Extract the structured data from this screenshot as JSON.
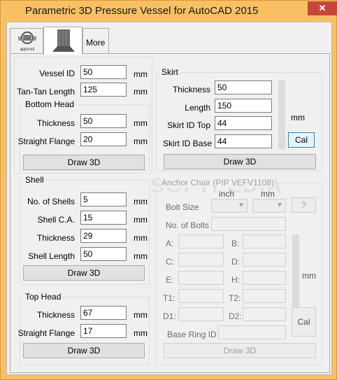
{
  "window": {
    "title": "Parametric 3D Pressure Vessel for AutoCAD 2015",
    "close": "✕"
  },
  "tabs": [
    {
      "label": "appsoul",
      "icon": "appsoul-logo-icon"
    },
    {
      "label": "",
      "icon": "vessel-icon"
    },
    {
      "label": "More"
    }
  ],
  "watermark": "SOFTPEDIA",
  "main": {
    "vessel_id": {
      "label": "Vessel ID",
      "value": "50",
      "unit": "mm"
    },
    "tan_tan": {
      "label": "Tan-Tan Length",
      "value": "125",
      "unit": "mm"
    }
  },
  "bottom_head": {
    "title": "Bottom Head",
    "thickness": {
      "label": "Thickness",
      "value": "50",
      "unit": "mm"
    },
    "straight_flange": {
      "label": "Straight Flange",
      "value": "20",
      "unit": "mm"
    },
    "draw": "Draw 3D"
  },
  "shell": {
    "title": "Shell",
    "num_shells": {
      "label": "No. of Shells",
      "value": "5",
      "unit": "mm"
    },
    "shell_ca": {
      "label": "Shell C.A.",
      "value": "15",
      "unit": "mm"
    },
    "thickness": {
      "label": "Thickness",
      "value": "29",
      "unit": "mm"
    },
    "shell_length": {
      "label": "Shell Length",
      "value": "50",
      "unit": "mm"
    },
    "draw": "Draw 3D"
  },
  "top_head": {
    "title": "Top Head",
    "thickness": {
      "label": "Thickness",
      "value": "67",
      "unit": "mm"
    },
    "straight_flange": {
      "label": "Straight Flange",
      "value": "17",
      "unit": "mm"
    },
    "draw": "Draw 3D"
  },
  "skirt": {
    "title": "Skirt",
    "thickness": {
      "label": "Thickness",
      "value": "50"
    },
    "length": {
      "label": "Length",
      "value": "150"
    },
    "id_top": {
      "label": "Skirt ID Top",
      "value": "44"
    },
    "id_base": {
      "label": "Skirt ID Base",
      "value": "44"
    },
    "unit": "mm",
    "cal": "Cal",
    "draw": "Draw 3D"
  },
  "anchor": {
    "title": "Anchor Chair (PIP VEFV1108)",
    "col_inch": "inch",
    "col_mm": "mm",
    "bolt_size": "Bolt Size",
    "help": "?",
    "num_bolts": "No. of Bolts",
    "a": "A:",
    "b": "B:",
    "c": "C:",
    "d": "D:",
    "e": "E:",
    "h": "H:",
    "t1": "T1:",
    "t2": "T2:",
    "d1": "D1:",
    "d2": "D2:",
    "base_ring": "Base Ring ID",
    "unit": "mm",
    "cal": "Cal",
    "draw": "Draw 3D"
  }
}
